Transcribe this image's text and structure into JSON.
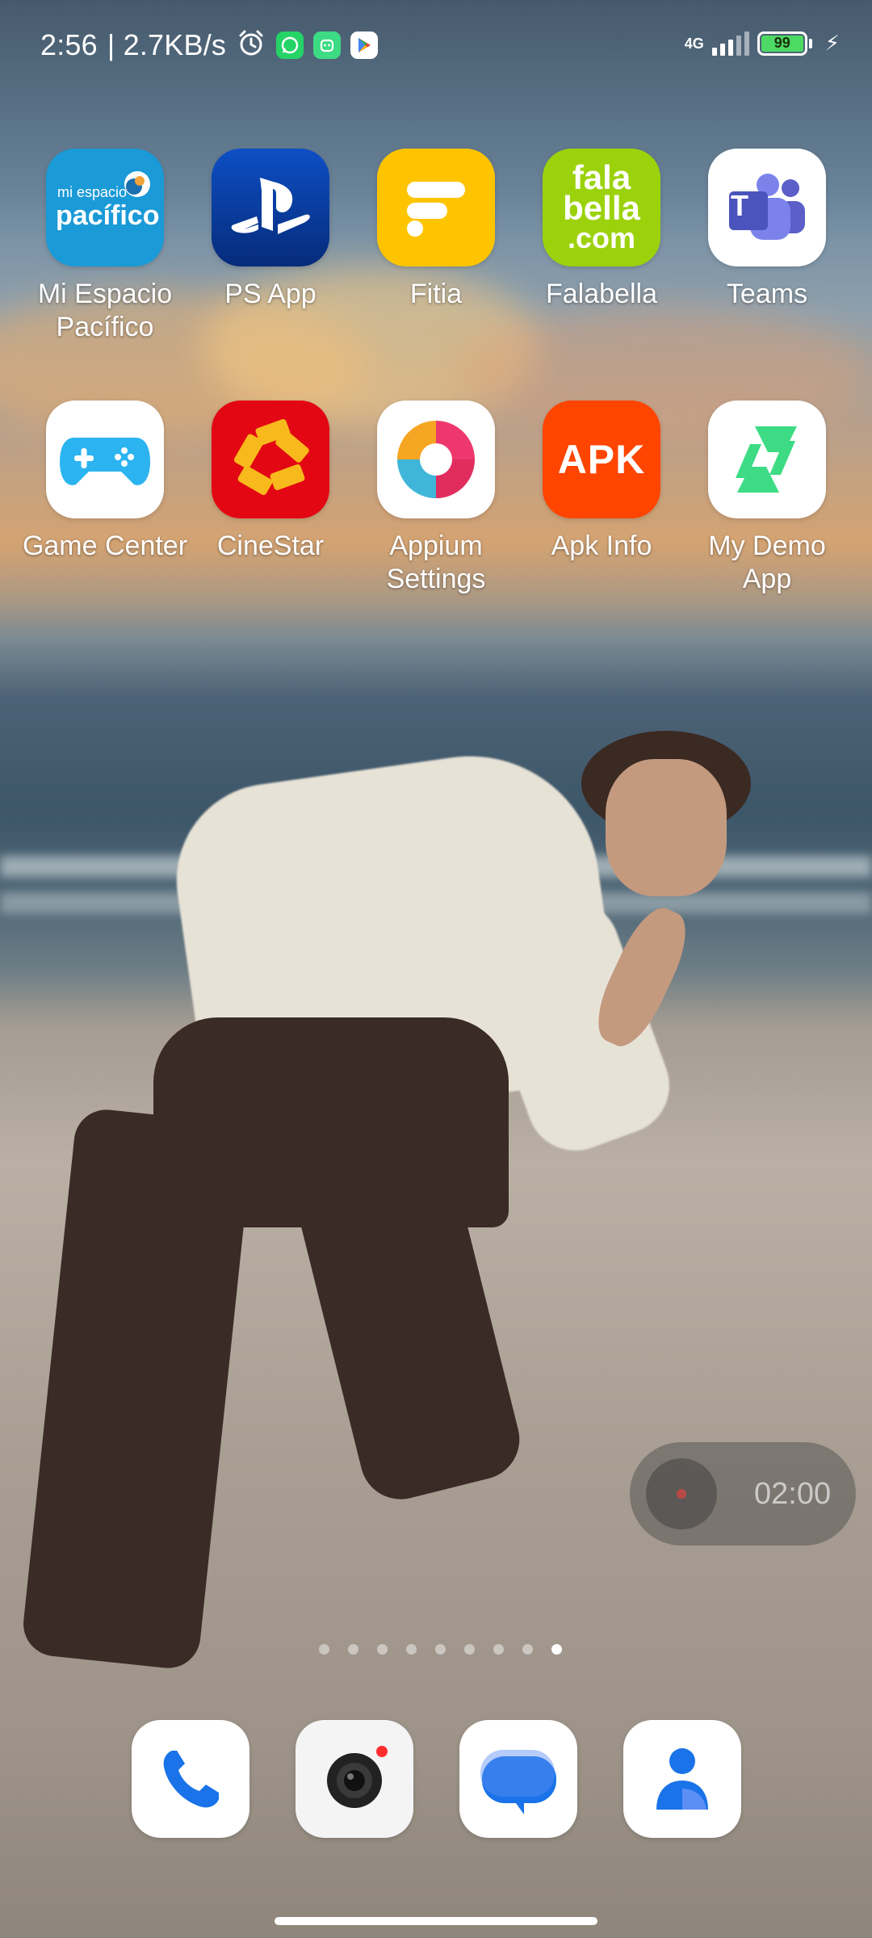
{
  "status_bar": {
    "time": "2:56",
    "speed": "| 2.7KB/s",
    "network_type": "4G",
    "battery_level": "99",
    "notification_icons": [
      "alarm-icon",
      "whatsapp-icon",
      "android-robot-icon",
      "play-store-icon"
    ]
  },
  "apps": [
    {
      "label": "Mi Espacio Pacífico",
      "icon": "mi-espacio-pacifico-icon",
      "icon_text_small": "mi espacio",
      "icon_text_big": "pacífico",
      "color": "#1a9ad6"
    },
    {
      "label": "PS App",
      "icon": "playstation-icon",
      "color": "#0b3fa8"
    },
    {
      "label": "Fitia",
      "icon": "fitia-icon",
      "color": "#ffc400"
    },
    {
      "label": "Falabella",
      "icon": "falabella-icon",
      "icon_text": [
        "fala",
        "bella",
        ".com"
      ],
      "color": "#9bd20c"
    },
    {
      "label": "Teams",
      "icon": "teams-icon",
      "icon_text": "T",
      "color": "#5b5fc7"
    },
    {
      "label": "Game Center",
      "icon": "gamepad-icon",
      "color": "#2bb4f0"
    },
    {
      "label": "CineStar",
      "icon": "cinestar-icon",
      "color": "#e30613"
    },
    {
      "label": "Appium Settings",
      "icon": "appium-icon",
      "color": "#ffffff"
    },
    {
      "label": "Apk Info",
      "icon": "apk-info-icon",
      "icon_text": "APK",
      "color": "#ff4500"
    },
    {
      "label": "My Demo App",
      "icon": "my-demo-app-icon",
      "color": "#3ddc84"
    }
  ],
  "timer": {
    "text": "02:00"
  },
  "page_indicator": {
    "count": 9,
    "active": 9
  },
  "dock": [
    {
      "name": "phone-icon",
      "color": "#1a73e8"
    },
    {
      "name": "camera-icon",
      "color": "#222222"
    },
    {
      "name": "messages-icon",
      "color": "#1a73e8"
    },
    {
      "name": "contacts-icon",
      "color": "#1a73e8"
    }
  ]
}
